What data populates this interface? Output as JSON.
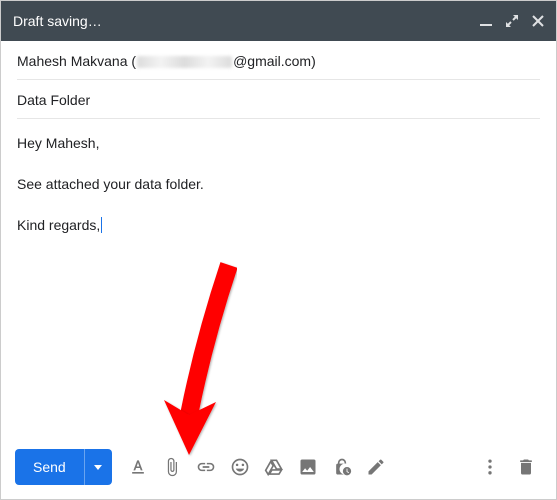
{
  "titlebar": {
    "title": "Draft saving…"
  },
  "to": {
    "name": "Mahesh Makvana",
    "domain": "@gmail.com)"
  },
  "subject": "Data Folder",
  "body": {
    "line1": "Hey Mahesh,",
    "line2": "See attached your data folder.",
    "line3": "Kind regards,"
  },
  "footer": {
    "send": "Send"
  }
}
